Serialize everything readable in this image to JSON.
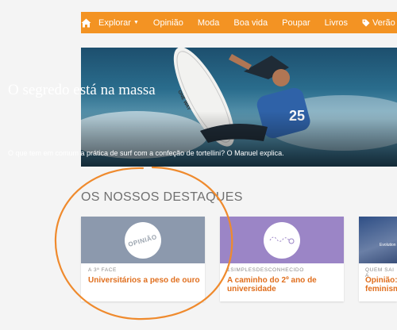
{
  "nav": {
    "home_icon": "home-icon",
    "items": [
      {
        "label": "Explorar",
        "has_caret": true
      },
      {
        "label": "Opinião"
      },
      {
        "label": "Moda"
      },
      {
        "label": "Boa vida"
      },
      {
        "label": "Poupar"
      },
      {
        "label": "Livros"
      },
      {
        "label": "Verão",
        "icon": "tag-icon"
      }
    ],
    "color": "#f39323"
  },
  "hero": {
    "title": "O segredo está na massa",
    "subtitle": "O que tem em comum a prática de surf com a confeção de tortellini? O Manuel explica.",
    "board_text": "ONE WAY",
    "jersey_number": "25"
  },
  "section": {
    "title": "OS NOSSOS DESTAQUES"
  },
  "cards": [
    {
      "category": "A 3ª FACE",
      "title": "Universitários a peso de ouro",
      "logo_text": "OPINIÃO",
      "bg": "#8c99ad"
    },
    {
      "category": "1SIMPLESDESCONHECIDO",
      "title": "A caminho do 2º ano de universidade",
      "bg": "#9b85c6"
    },
    {
      "category": "QUEM SAI A",
      "title": "Opinião: feminism",
      "bg": "#2f4f86",
      "image_text": "Evolution"
    }
  ],
  "annotation": {
    "color": "#ef8a2d"
  }
}
